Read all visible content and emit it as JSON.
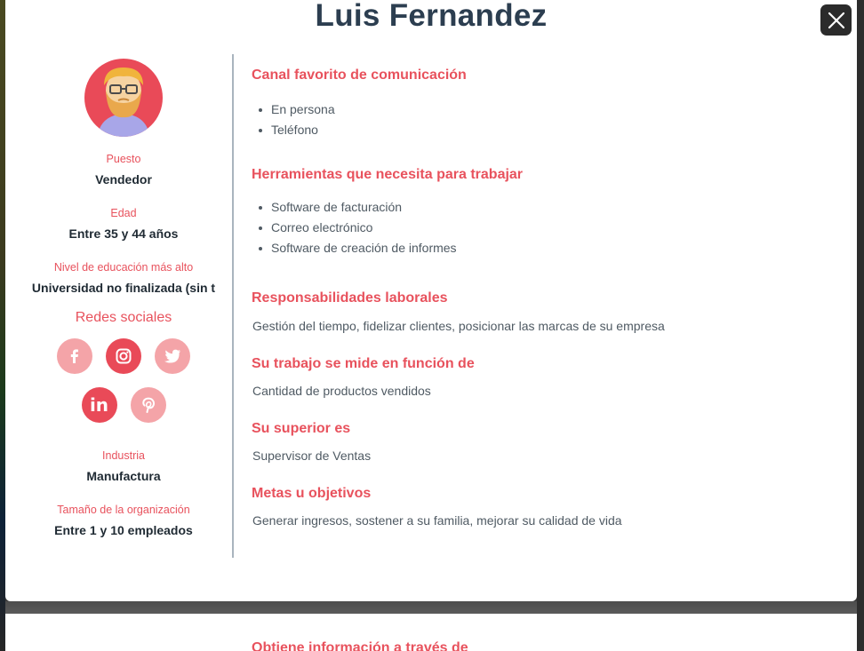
{
  "persona": {
    "name": "Luis Fernandez"
  },
  "profile": {
    "puesto_label": "Puesto",
    "puesto_value": "Vendedor",
    "edad_label": "Edad",
    "edad_value": "Entre 35 y 44 años",
    "educacion_label": "Nivel de educación más alto",
    "educacion_value": "Universidad no finalizada (sin t",
    "redes_title": "Redes sociales",
    "industria_label": "Industria",
    "industria_value": "Manufactura",
    "tamano_label": "Tamaño de la organización",
    "tamano_value": "Entre 1 y 10 empleados"
  },
  "social": [
    {
      "name": "facebook",
      "glyph": "f",
      "active": false
    },
    {
      "name": "instagram",
      "glyph": "",
      "active": true
    },
    {
      "name": "twitter",
      "glyph": "",
      "active": false
    },
    {
      "name": "linkedin",
      "glyph": "in",
      "active": true
    },
    {
      "name": "pinterest",
      "glyph": "P",
      "active": false
    }
  ],
  "sections": {
    "canal": {
      "title": "Canal favorito de comunicación",
      "items": [
        "En persona",
        "Teléfono"
      ]
    },
    "herramientas": {
      "title": "Herramientas que necesita para trabajar",
      "items": [
        "Software de facturación",
        "Correo electrónico",
        "Software de creación de informes"
      ]
    },
    "responsabilidades": {
      "title": "Responsabilidades laborales",
      "text": "Gestión del tiempo, fidelizar clientes, posicionar las marcas de su empresa"
    },
    "medida": {
      "title": "Su trabajo se mide en función de",
      "text": "Cantidad de productos vendidos"
    },
    "superior": {
      "title": "Su superior es",
      "text": "Supervisor de Ventas"
    },
    "metas": {
      "title": "Metas u objetivos",
      "text": "Generar ingresos, sostener a su familia, mejorar su calidad de vida"
    }
  },
  "bottom": {
    "title": "Obtiene información a través de"
  },
  "colors": {
    "accent": "#e8525d",
    "heading": "#2c3e50",
    "social_active": "#e94a58",
    "social_inactive": "#f4a4a8"
  },
  "icons": {
    "close": "close-icon",
    "avatar": "avatar-icon"
  }
}
